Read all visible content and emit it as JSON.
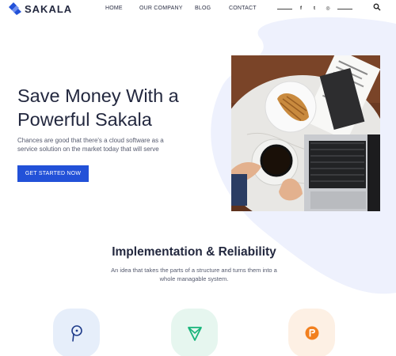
{
  "header": {
    "brand": "SAKALA",
    "nav": [
      "HOME",
      "OUR COMPANY",
      "BLOG",
      "CONTACT"
    ],
    "social": [
      {
        "icon": "facebook-icon",
        "glyph": "f"
      },
      {
        "icon": "twitter-icon",
        "glyph": "t"
      },
      {
        "icon": "instagram-icon",
        "glyph": "◎"
      }
    ],
    "search_icon": "search-icon"
  },
  "hero": {
    "title": "Save Money With a Powerful Sakala",
    "description": "Chances are good that there's a cloud software as a service solution on the market today that will serve",
    "cta_label": "GET STARTED NOW",
    "image": "desk-coffee-laptop-photo"
  },
  "section": {
    "title": "Implementation & Reliability",
    "description": "An idea that takes the parts of a structure and turns them into a whole managable system."
  },
  "features": [
    {
      "icon": "pen-nib-icon",
      "bg": "#e6eefa",
      "color": "#1f3c8a"
    },
    {
      "icon": "send-triangle-icon",
      "bg": "#e6f6ef",
      "color": "#17b47a"
    },
    {
      "icon": "r-badge-icon",
      "bg": "#fdf0e4",
      "color": "#f2801f"
    }
  ],
  "colors": {
    "accent": "#2251d8",
    "blob": "#eef1fd",
    "heading": "#23283f"
  }
}
